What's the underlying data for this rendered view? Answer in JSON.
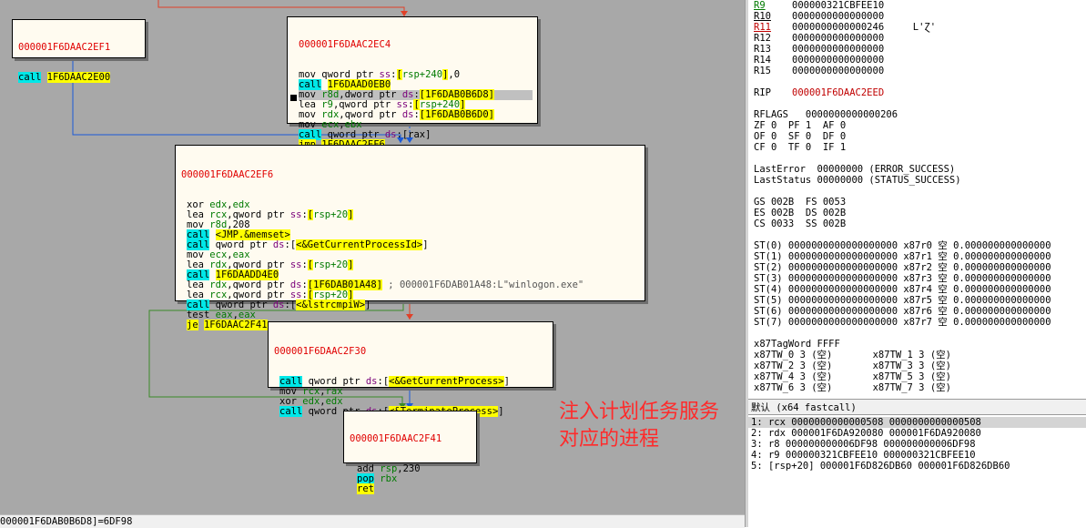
{
  "graph": {
    "blocks": [
      {
        "addr": "000001F6DAAC2EF1",
        "lines": [
          [
            [
              "m-call",
              "call"
            ],
            [
              "",
              " "
            ],
            [
              "imm",
              "1F6DAAC2E00"
            ]
          ]
        ]
      },
      {
        "addr": "000001F6DAAC2EC4",
        "lines": [
          [
            [
              "",
              "mov qword ptr "
            ],
            [
              "seg",
              "ss"
            ],
            [
              "",
              ":"
            ],
            [
              "imm",
              "["
            ],
            [
              "reg",
              "rsp+240"
            ],
            [
              "imm",
              "]"
            ],
            [
              "",
              ",0"
            ]
          ],
          [
            [
              "m-call",
              "call"
            ],
            [
              "",
              " "
            ],
            [
              "imm",
              "1F6DAAD0EB0"
            ]
          ],
          [
            [
              "",
              "mov "
            ],
            [
              "reg",
              "r8d"
            ],
            [
              "",
              ",dword ptr "
            ],
            [
              "seg",
              "ds"
            ],
            [
              "",
              ":"
            ],
            [
              "imm",
              "[1F6DAB0B6D8]"
            ]
          ],
          [
            [
              "",
              "lea "
            ],
            [
              "reg",
              "r9"
            ],
            [
              "",
              ",qword ptr "
            ],
            [
              "seg",
              "ss"
            ],
            [
              "",
              ":"
            ],
            [
              "imm",
              "["
            ],
            [
              "reg",
              "rsp+240"
            ],
            [
              "imm",
              "]"
            ]
          ],
          [
            [
              "",
              "mov "
            ],
            [
              "reg",
              "rdx"
            ],
            [
              "",
              ",qword ptr "
            ],
            [
              "seg",
              "ds"
            ],
            [
              "",
              ":"
            ],
            [
              "imm",
              "[1F6DAB0B6D0]"
            ]
          ],
          [
            [
              "",
              "mov "
            ],
            [
              "reg",
              "ecx"
            ],
            [
              "",
              ","
            ],
            [
              "reg",
              "ebx"
            ]
          ],
          [
            [
              "m-call",
              "call"
            ],
            [
              "",
              " qword ptr "
            ],
            [
              "seg",
              "ds"
            ],
            [
              "",
              ":[rax]"
            ]
          ],
          [
            [
              "m-jmp",
              "jmp"
            ],
            [
              "",
              " "
            ],
            [
              "imm",
              "1F6DAAC2EF6"
            ]
          ]
        ]
      },
      {
        "addr": "000001F6DAAC2EF6",
        "lines": [
          [
            [
              "",
              "xor "
            ],
            [
              "reg",
              "edx"
            ],
            [
              "",
              ","
            ],
            [
              "reg",
              "edx"
            ]
          ],
          [
            [
              "",
              "lea "
            ],
            [
              "reg",
              "rcx"
            ],
            [
              "",
              ",qword ptr "
            ],
            [
              "seg",
              "ss"
            ],
            [
              "",
              ":"
            ],
            [
              "imm",
              "["
            ],
            [
              "reg",
              "rsp+20"
            ],
            [
              "imm",
              "]"
            ]
          ],
          [
            [
              "",
              "mov "
            ],
            [
              "reg",
              "r8d"
            ],
            [
              "",
              ",208"
            ]
          ],
          [
            [
              "m-call",
              "call"
            ],
            [
              "",
              " "
            ],
            [
              "imm",
              "<JMP.&memset>"
            ]
          ],
          [
            [
              "m-call",
              "call"
            ],
            [
              "",
              " qword ptr "
            ],
            [
              "seg",
              "ds"
            ],
            [
              "",
              ":["
            ],
            [
              "imm",
              "<&GetCurrentProcessId>"
            ],
            [
              "",
              "]"
            ]
          ],
          [
            [
              "",
              "mov "
            ],
            [
              "reg",
              "ecx"
            ],
            [
              "",
              ","
            ],
            [
              "reg",
              "eax"
            ]
          ],
          [
            [
              "",
              "lea "
            ],
            [
              "reg",
              "rdx"
            ],
            [
              "",
              ",qword ptr "
            ],
            [
              "seg",
              "ss"
            ],
            [
              "",
              ":"
            ],
            [
              "imm",
              "["
            ],
            [
              "reg",
              "rsp+20"
            ],
            [
              "imm",
              "]"
            ]
          ],
          [
            [
              "m-call",
              "call"
            ],
            [
              "",
              " "
            ],
            [
              "imm",
              "1F6DAADD4E0"
            ]
          ],
          [
            [
              "",
              "lea "
            ],
            [
              "reg",
              "rdx"
            ],
            [
              "",
              ",qword ptr "
            ],
            [
              "seg",
              "ds"
            ],
            [
              "",
              ":"
            ],
            [
              "imm",
              "[1F6DAB01A48]"
            ],
            [
              "cmt",
              " ; 000001F6DAB01A48:L\"winlogon.exe\""
            ]
          ],
          [
            [
              "",
              "lea "
            ],
            [
              "reg",
              "rcx"
            ],
            [
              "",
              ",qword ptr "
            ],
            [
              "seg",
              "ss"
            ],
            [
              "",
              ":"
            ],
            [
              "imm",
              "["
            ],
            [
              "reg",
              "rsp+20"
            ],
            [
              "imm",
              "]"
            ]
          ],
          [
            [
              "m-call",
              "call"
            ],
            [
              "",
              " qword ptr "
            ],
            [
              "seg",
              "ds"
            ],
            [
              "",
              ":["
            ],
            [
              "imm",
              "<&lstrcmpiW>"
            ],
            [
              "",
              "]"
            ]
          ],
          [
            [
              "",
              "test "
            ],
            [
              "reg",
              "eax"
            ],
            [
              "",
              ","
            ],
            [
              "reg",
              "eax"
            ]
          ],
          [
            [
              "m-jmp",
              "je"
            ],
            [
              "",
              " "
            ],
            [
              "imm",
              "1F6DAAC2F41"
            ]
          ]
        ]
      },
      {
        "addr": "000001F6DAAC2F30",
        "lines": [
          [
            [
              "m-call",
              "call"
            ],
            [
              "",
              " qword ptr "
            ],
            [
              "seg",
              "ds"
            ],
            [
              "",
              ":["
            ],
            [
              "imm",
              "<&GetCurrentProcess>"
            ],
            [
              "",
              "]"
            ]
          ],
          [
            [
              "",
              "mov "
            ],
            [
              "reg",
              "rcx"
            ],
            [
              "",
              ","
            ],
            [
              "reg",
              "rax"
            ]
          ],
          [
            [
              "",
              "xor "
            ],
            [
              "reg",
              "edx"
            ],
            [
              "",
              ","
            ],
            [
              "reg",
              "edx"
            ]
          ],
          [
            [
              "m-call",
              "call"
            ],
            [
              "",
              " qword ptr "
            ],
            [
              "seg",
              "ds"
            ],
            [
              "",
              ":["
            ],
            [
              "imm",
              "<&TerminateProcess>"
            ],
            [
              "",
              "]"
            ]
          ]
        ]
      },
      {
        "addr": "000001F6DAAC2F41",
        "lines": [
          [
            [
              "",
              "add "
            ],
            [
              "reg",
              "rsp"
            ],
            [
              "",
              ",230"
            ]
          ],
          [
            [
              "m-call",
              "pop"
            ],
            [
              "",
              " "
            ],
            [
              "reg",
              "rbx"
            ]
          ],
          [
            [
              "m-jmp",
              "ret"
            ]
          ]
        ]
      }
    ],
    "annotation": "注入计划任务服务\n对应的进程",
    "colors": {
      "edge_red": "#e04028",
      "edge_blue": "#1a5ad8",
      "edge_green": "#3a8a28"
    }
  },
  "statusbar": {
    "text": "000001F6DAB0B6D8]=6DF98"
  },
  "registers": {
    "rows": [
      {
        "name": "R9",
        "value": "000000321CBFEE10",
        "style": "green u"
      },
      {
        "name": "R10",
        "value": "0000000000000000",
        "style": "u"
      },
      {
        "name": "R11",
        "value": "0000000000000246",
        "extra": "     L'Ɀ'",
        "style": "u"
      },
      {
        "name": "R12",
        "value": "0000000000000000",
        "style": ""
      },
      {
        "name": "R13",
        "value": "0000000000000000",
        "style": ""
      },
      {
        "name": "R14",
        "value": "0000000000000000",
        "style": ""
      },
      {
        "name": "R15",
        "value": "0000000000000000",
        "style": ""
      },
      {
        "name": "",
        "value": "",
        "style": ""
      },
      {
        "name": "RIP",
        "value": "000001F6DAAC2EED",
        "style": "",
        "valstyle": "red"
      },
      {
        "name": "",
        "value": "",
        "style": ""
      },
      {
        "name": "",
        "value": "RFLAGS   0000000000000206",
        "style": ""
      },
      {
        "name": "",
        "value": "ZF 0  PF 1  AF 0",
        "style": ""
      },
      {
        "name": "",
        "value": "OF 0  SF 0  DF 0",
        "style": ""
      },
      {
        "name": "",
        "value": "CF 0  TF 0  IF 1",
        "style": ""
      },
      {
        "name": "",
        "value": "",
        "style": ""
      },
      {
        "name": "",
        "value": "LastError  00000000 (ERROR_SUCCESS)",
        "style": ""
      },
      {
        "name": "",
        "value": "LastStatus 00000000 (STATUS_SUCCESS)",
        "style": ""
      },
      {
        "name": "",
        "value": "",
        "style": ""
      },
      {
        "name": "",
        "value": "GS 002B  FS 0053",
        "style": ""
      },
      {
        "name": "",
        "value": "ES 002B  DS 002B",
        "style": ""
      },
      {
        "name": "",
        "value": "CS 0033  SS 002B",
        "style": ""
      },
      {
        "name": "",
        "value": "",
        "style": ""
      },
      {
        "name": "",
        "value": "ST(0) 0000000000000000000 x87r0 空 0.000000000000000",
        "style": ""
      },
      {
        "name": "",
        "value": "ST(1) 0000000000000000000 x87r1 空 0.000000000000000",
        "style": ""
      },
      {
        "name": "",
        "value": "ST(2) 0000000000000000000 x87r2 空 0.000000000000000",
        "style": ""
      },
      {
        "name": "",
        "value": "ST(3) 0000000000000000000 x87r3 空 0.000000000000000",
        "style": ""
      },
      {
        "name": "",
        "value": "ST(4) 0000000000000000000 x87r4 空 0.000000000000000",
        "style": ""
      },
      {
        "name": "",
        "value": "ST(5) 0000000000000000000 x87r5 空 0.000000000000000",
        "style": ""
      },
      {
        "name": "",
        "value": "ST(6) 0000000000000000000 x87r6 空 0.000000000000000",
        "style": ""
      },
      {
        "name": "",
        "value": "ST(7) 0000000000000000000 x87r7 空 0.000000000000000",
        "style": ""
      },
      {
        "name": "",
        "value": "",
        "style": ""
      },
      {
        "name": "",
        "value": "x87TagWord FFFF",
        "style": ""
      },
      {
        "name": "",
        "value": "x87TW_0 3 (空)       x87TW_1 3 (空)",
        "style": ""
      },
      {
        "name": "",
        "value": "x87TW_2 3 (空)       x87TW_3 3 (空)",
        "style": ""
      },
      {
        "name": "",
        "value": "x87TW_4 3 (空)       x87TW_5 3 (空)",
        "style": ""
      },
      {
        "name": "",
        "value": "x87TW_6 3 (空)       x87TW_7 3 (空)",
        "style": ""
      }
    ]
  },
  "callconv": {
    "header": "默认 (x64 fastcall)",
    "args": [
      "1: rcx 0000000000000508 0000000000000508",
      "2: rdx 000001F6DA920080 000001F6DA920080",
      "3: r8 000000000006DF98 000000000006DF98",
      "4: r9 000000321CBFEE10 000000321CBFEE10",
      "5: [rsp+20] 000001F6D826DB60 000001F6D826DB60"
    ]
  }
}
